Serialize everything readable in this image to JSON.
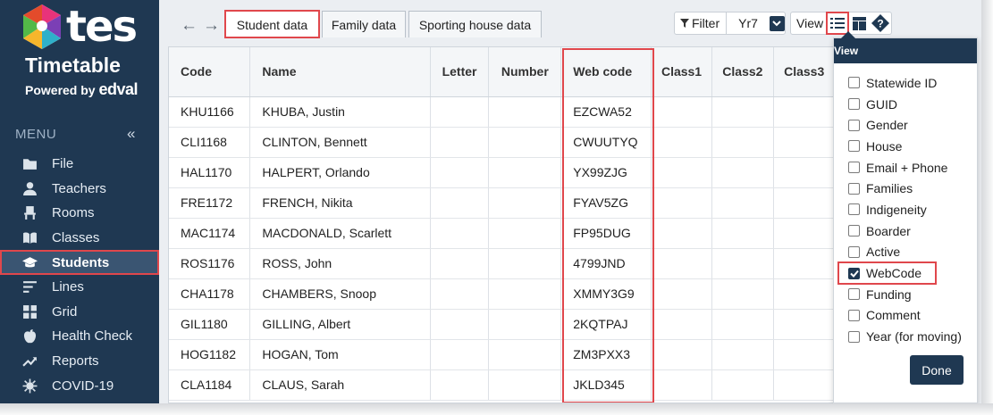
{
  "brand": {
    "logo_word": "tes",
    "product": "Timetable",
    "powered_prefix": "Powered by",
    "powered_brand": "edval"
  },
  "sidebar": {
    "menu_label": "MENU",
    "collapse_glyph": "«",
    "items": [
      {
        "label": "File",
        "icon": "folder-icon"
      },
      {
        "label": "Teachers",
        "icon": "person-icon"
      },
      {
        "label": "Rooms",
        "icon": "chair-icon"
      },
      {
        "label": "Classes",
        "icon": "book-icon"
      },
      {
        "label": "Students",
        "icon": "graduation-cap-icon",
        "active": true
      },
      {
        "label": "Lines",
        "icon": "lines-icon"
      },
      {
        "label": "Grid",
        "icon": "grid-icon"
      },
      {
        "label": "Health Check",
        "icon": "apple-icon"
      },
      {
        "label": "Reports",
        "icon": "trend-icon"
      },
      {
        "label": "COVID-19",
        "icon": "virus-icon"
      }
    ]
  },
  "toolbar": {
    "back_glyph": "←",
    "forward_glyph": "→",
    "tabs": [
      {
        "label": "Student data",
        "active": true
      },
      {
        "label": "Family data"
      },
      {
        "label": "Sporting house data"
      }
    ],
    "filter_label": "Filter",
    "year_value": "Yr7",
    "view_label": "View"
  },
  "table": {
    "columns": [
      "Code",
      "Name",
      "Letter",
      "Number",
      "Web code",
      "Class1",
      "Class2",
      "Class3"
    ],
    "rows": [
      {
        "code": "KHU1166",
        "name": "KHUBA, Justin",
        "webcode": "EZCWA52"
      },
      {
        "code": "CLI1168",
        "name": "CLINTON, Bennett",
        "webcode": "CWUUTYQ"
      },
      {
        "code": "HAL1170",
        "name": "HALPERT, Orlando",
        "webcode": "YX99ZJG"
      },
      {
        "code": "FRE1172",
        "name": "FRENCH, Nikita",
        "webcode": "FYAV5ZG"
      },
      {
        "code": "MAC1174",
        "name": "MACDONALD, Scarlett",
        "webcode": "FP95DUG"
      },
      {
        "code": "ROS1176",
        "name": "ROSS, John",
        "webcode": "4799JND"
      },
      {
        "code": "CHA1178",
        "name": "CHAMBERS, Snoop",
        "webcode": "XMMY3G9"
      },
      {
        "code": "GIL1180",
        "name": "GILLING, Albert",
        "webcode": "2KQTPAJ"
      },
      {
        "code": "HOG1182",
        "name": "HOGAN, Tom",
        "webcode": "ZM3PXX3"
      },
      {
        "code": "CLA1184",
        "name": "CLAUS, Sarah",
        "webcode": "JKLD345"
      }
    ]
  },
  "view_menu": {
    "title": "View",
    "options": [
      {
        "label": "Statewide ID",
        "checked": false
      },
      {
        "label": "GUID",
        "checked": false
      },
      {
        "label": "Gender",
        "checked": false
      },
      {
        "label": "House",
        "checked": false
      },
      {
        "label": "Email + Phone",
        "checked": false
      },
      {
        "label": "Families",
        "checked": false
      },
      {
        "label": "Indigeneity",
        "checked": false
      },
      {
        "label": "Boarder",
        "checked": false
      },
      {
        "label": "Active",
        "checked": false
      },
      {
        "label": "WebCode",
        "checked": true
      },
      {
        "label": "Funding",
        "checked": false
      },
      {
        "label": "Comment",
        "checked": false
      },
      {
        "label": "Year (for moving)",
        "checked": false
      }
    ],
    "done_label": "Done"
  },
  "colors": {
    "sidebar_bg": "#1f3852",
    "highlight_red": "#e0474c",
    "main_bg": "#ebeef2"
  }
}
